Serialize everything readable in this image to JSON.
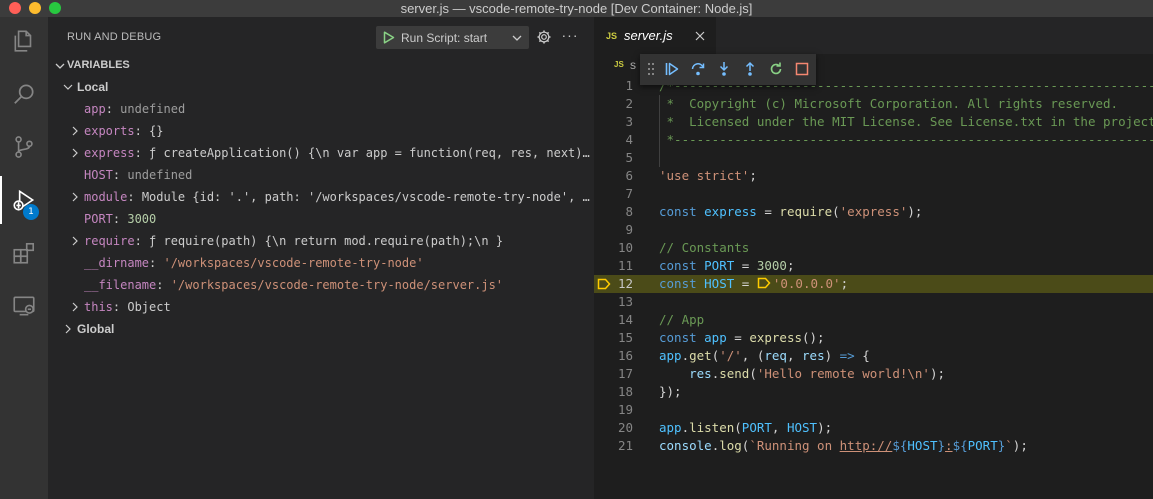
{
  "window": {
    "title": "server.js — vscode-remote-try-node [Dev Container: Node.js]"
  },
  "activity_bar": {
    "items": [
      {
        "name": "explorer"
      },
      {
        "name": "search"
      },
      {
        "name": "source-control"
      },
      {
        "name": "run-and-debug",
        "active": true,
        "badge": "1"
      },
      {
        "name": "extensions"
      },
      {
        "name": "remote-explorer"
      }
    ]
  },
  "sidebar": {
    "title": "RUN AND DEBUG",
    "config_label": "Run Script: start",
    "variables_label": "VARIABLES",
    "scopes": [
      {
        "label": "Local",
        "expanded": true,
        "vars": [
          {
            "name": "app",
            "value": "undefined",
            "type": "undef",
            "expandable": false
          },
          {
            "name": "exports",
            "value": "{}",
            "type": "obj",
            "expandable": true
          },
          {
            "name": "express",
            "value": "ƒ createApplication() {\\n  var app = function(req, res, next) {\\n  …",
            "type": "fn",
            "expandable": true
          },
          {
            "name": "HOST",
            "value": "undefined",
            "type": "undef",
            "expandable": false
          },
          {
            "name": "module",
            "value": "Module {id: '.', path: '/workspaces/vscode-remote-try-node', exports…",
            "type": "obj",
            "expandable": true
          },
          {
            "name": "PORT",
            "value": "3000",
            "type": "num",
            "expandable": false
          },
          {
            "name": "require",
            "value": "ƒ require(path) {\\n      return mod.require(path);\\n    }",
            "type": "fn",
            "expandable": true
          },
          {
            "name": "__dirname",
            "value": "'/workspaces/vscode-remote-try-node'",
            "type": "str",
            "expandable": false
          },
          {
            "name": "__filename",
            "value": "'/workspaces/vscode-remote-try-node/server.js'",
            "type": "str",
            "expandable": false
          },
          {
            "name": "this",
            "value": "Object",
            "type": "obj",
            "expandable": true
          }
        ]
      },
      {
        "label": "Global",
        "expanded": false,
        "vars": []
      }
    ]
  },
  "editor": {
    "tab": {
      "icon": "JS",
      "label": "server.js"
    },
    "breadcrumb": {
      "icon": "JS",
      "label": "s"
    },
    "current_line": 12,
    "lines": [
      [
        [
          "c-com",
          "/*----------------------------------------------------------------------------------------"
        ]
      ],
      [
        [
          "c-com",
          " *  Copyright (c) Microsoft Corporation. All rights reserved."
        ]
      ],
      [
        [
          "c-com",
          " *  Licensed under the MIT License. See License.txt in the project root for license information."
        ]
      ],
      [
        [
          "c-com",
          " *---------------------------------------------------------------------------------------*/"
        ]
      ],
      [],
      [
        [
          "c-str",
          "'use strict'"
        ],
        [
          "c-txt",
          ";"
        ]
      ],
      [],
      [
        [
          "c-kw",
          "const "
        ],
        [
          "c-const",
          "express"
        ],
        [
          "c-txt",
          " = "
        ],
        [
          "c-fn",
          "require"
        ],
        [
          "c-txt",
          "("
        ],
        [
          "c-str",
          "'express'"
        ],
        [
          "c-txt",
          ");"
        ]
      ],
      [],
      [
        [
          "c-com",
          "// Constants"
        ]
      ],
      [
        [
          "c-kw",
          "const "
        ],
        [
          "c-const",
          "PORT"
        ],
        [
          "c-txt",
          " = "
        ],
        [
          "c-num",
          "3000"
        ],
        [
          "c-txt",
          ";"
        ]
      ],
      [
        [
          "c-kw",
          "const "
        ],
        [
          "c-const",
          "HOST"
        ],
        [
          "c-txt",
          " = "
        ],
        [
          "bp",
          ""
        ],
        [
          "c-str",
          "'0.0.0.0'"
        ],
        [
          "c-txt",
          ";"
        ]
      ],
      [],
      [
        [
          "c-com",
          "// App"
        ]
      ],
      [
        [
          "c-kw",
          "const "
        ],
        [
          "c-const",
          "app"
        ],
        [
          "c-txt",
          " = "
        ],
        [
          "c-fn",
          "express"
        ],
        [
          "c-txt",
          "();"
        ]
      ],
      [
        [
          "c-const",
          "app"
        ],
        [
          "c-txt",
          "."
        ],
        [
          "c-fn",
          "get"
        ],
        [
          "c-txt",
          "("
        ],
        [
          "c-str",
          "'/'"
        ],
        [
          "c-txt",
          ", ("
        ],
        [
          "c-var",
          "req"
        ],
        [
          "c-txt",
          ", "
        ],
        [
          "c-var",
          "res"
        ],
        [
          "c-txt",
          ") "
        ],
        [
          "c-kw",
          "=>"
        ],
        [
          "c-txt",
          " {"
        ]
      ],
      [
        [
          "c-txt",
          "    "
        ],
        [
          "c-var",
          "res"
        ],
        [
          "c-txt",
          "."
        ],
        [
          "c-fn",
          "send"
        ],
        [
          "c-txt",
          "("
        ],
        [
          "c-str",
          "'Hello remote world!\\n'"
        ],
        [
          "c-txt",
          ");"
        ]
      ],
      [
        [
          "c-txt",
          "});"
        ]
      ],
      [],
      [
        [
          "c-const",
          "app"
        ],
        [
          "c-txt",
          "."
        ],
        [
          "c-fn",
          "listen"
        ],
        [
          "c-txt",
          "("
        ],
        [
          "c-const",
          "PORT"
        ],
        [
          "c-txt",
          ", "
        ],
        [
          "c-const",
          "HOST"
        ],
        [
          "c-txt",
          ");"
        ]
      ],
      [
        [
          "c-var",
          "console"
        ],
        [
          "c-txt",
          "."
        ],
        [
          "c-fn",
          "log"
        ],
        [
          "c-txt",
          "("
        ],
        [
          "c-str",
          "`Running on "
        ],
        [
          "c-url",
          "http://"
        ],
        [
          "c-tpl",
          "${"
        ],
        [
          "c-const",
          "HOST"
        ],
        [
          "c-tpl",
          "}"
        ],
        [
          "c-url",
          ":"
        ],
        [
          "c-tpl",
          "${"
        ],
        [
          "c-const",
          "PORT"
        ],
        [
          "c-tpl",
          "}"
        ],
        [
          "c-str",
          "`"
        ],
        [
          "c-txt",
          ");"
        ]
      ]
    ]
  },
  "colors": {
    "accent": "#007acc",
    "current_line_bg": "#4b4b18",
    "breakpoint_arrow": "#ffcc00"
  }
}
